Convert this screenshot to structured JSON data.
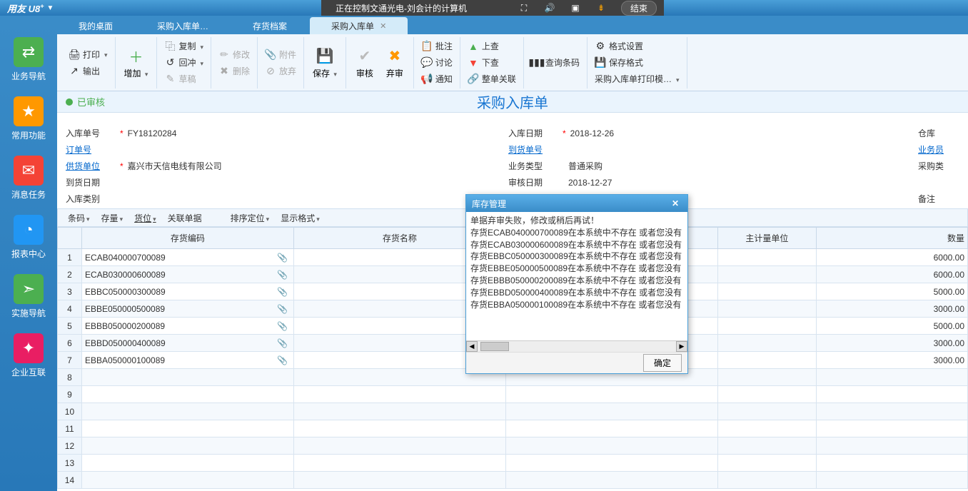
{
  "remote": {
    "label": "正在控制文通光电-刘会计的计算机",
    "end_btn": "结束"
  },
  "titlebar": {
    "logo": "用友 U8",
    "sup": "+"
  },
  "tabs": [
    {
      "label": "我的桌面",
      "active": false
    },
    {
      "label": "采购入库单…",
      "active": false
    },
    {
      "label": "存货档案",
      "active": false
    },
    {
      "label": "采购入库单",
      "active": true
    }
  ],
  "sidebar": [
    {
      "label": "业务导航",
      "color": "#4caf50",
      "glyph": "⇄"
    },
    {
      "label": "常用功能",
      "color": "#ff9800",
      "glyph": "★"
    },
    {
      "label": "消息任务",
      "color": "#f44336",
      "glyph": "✉"
    },
    {
      "label": "报表中心",
      "color": "#2196f3",
      "glyph": "◔"
    },
    {
      "label": "实施导航",
      "color": "#4caf50",
      "glyph": "➣"
    },
    {
      "label": "企业互联",
      "color": "#e91e63",
      "glyph": "✦"
    }
  ],
  "toolbar": {
    "print": "打印",
    "output": "输出",
    "add": "增加",
    "copy": "复制",
    "reverse": "回冲",
    "draft": "草稿",
    "modify": "修改",
    "attach": "附件",
    "delete": "删除",
    "abandon": "放弃",
    "save": "保存",
    "audit": "审核",
    "unaudit": "弃审",
    "batch": "批注",
    "discuss": "讨论",
    "notify": "通知",
    "up": "上查",
    "down": "下查",
    "related": "整单关联",
    "barcode": "查询条码",
    "fmt_set": "格式设置",
    "fmt_save": "保存格式",
    "print_tpl": "采购入库单打印模…"
  },
  "status": {
    "text": "已审核"
  },
  "doc_title": "采购入库单",
  "form": {
    "rk_no_label": "入库单号",
    "rk_no": "FY18120284",
    "order_label": "订单号",
    "supplier_label": "供货单位",
    "supplier": "嘉兴市天信电线有限公司",
    "arrive_date_label": "到货日期",
    "rk_type_label": "入库类别",
    "rk_date_label": "入库日期",
    "rk_date": "2018-12-26",
    "arrive_no_label": "到货单号",
    "biz_type_label": "业务类型",
    "biz_type": "普通采购",
    "audit_date_label": "审核日期",
    "audit_date": "2018-12-27",
    "warehouse_label": "仓库",
    "operator_label": "业务员",
    "purchase_type_label": "采购类",
    "remark_label": "备注"
  },
  "grid_toolbar": {
    "barcode": "条码",
    "stock": "存量",
    "loc": "货位",
    "related": "关联单据",
    "sort": "排序定位",
    "display": "显示格式"
  },
  "grid": {
    "headers": {
      "code": "存货编码",
      "name": "存货名称",
      "unit": "主计量单位",
      "qty": "数量"
    },
    "rows": [
      {
        "n": 1,
        "code": "ECAB040000700089",
        "qty": "6000.00"
      },
      {
        "n": 2,
        "code": "ECAB030000600089",
        "qty": "6000.00"
      },
      {
        "n": 3,
        "code": "EBBC050000300089",
        "qty": "5000.00"
      },
      {
        "n": 4,
        "code": "EBBE050000500089",
        "qty": "3000.00"
      },
      {
        "n": 5,
        "code": "EBBB050000200089",
        "qty": "5000.00"
      },
      {
        "n": 6,
        "code": "EBBD050000400089",
        "qty": "3000.00"
      },
      {
        "n": 7,
        "code": "EBBA050000100089",
        "qty": "3000.00"
      },
      {
        "n": 8,
        "code": "",
        "qty": ""
      },
      {
        "n": 9,
        "code": "",
        "qty": ""
      },
      {
        "n": 10,
        "code": "",
        "qty": ""
      },
      {
        "n": 11,
        "code": "",
        "qty": ""
      },
      {
        "n": 12,
        "code": "",
        "qty": ""
      },
      {
        "n": 13,
        "code": "",
        "qty": ""
      },
      {
        "n": 14,
        "code": "",
        "qty": ""
      }
    ]
  },
  "dialog": {
    "title": "库存管理",
    "lines": [
      "单据弃审失败，修改或稍后再试！",
      "存货ECAB040000700089在本系统中不存在 或者您没有",
      "存货ECAB030000600089在本系统中不存在 或者您没有",
      "存货EBBC050000300089在本系统中不存在 或者您没有",
      "存货EBBE050000500089在本系统中不存在 或者您没有",
      "存货EBBB050000200089在本系统中不存在 或者您没有",
      "存货EBBD050000400089在本系统中不存在 或者您没有",
      "存货EBBA050000100089在本系统中不存在 或者您没有"
    ],
    "ok": "确定"
  }
}
